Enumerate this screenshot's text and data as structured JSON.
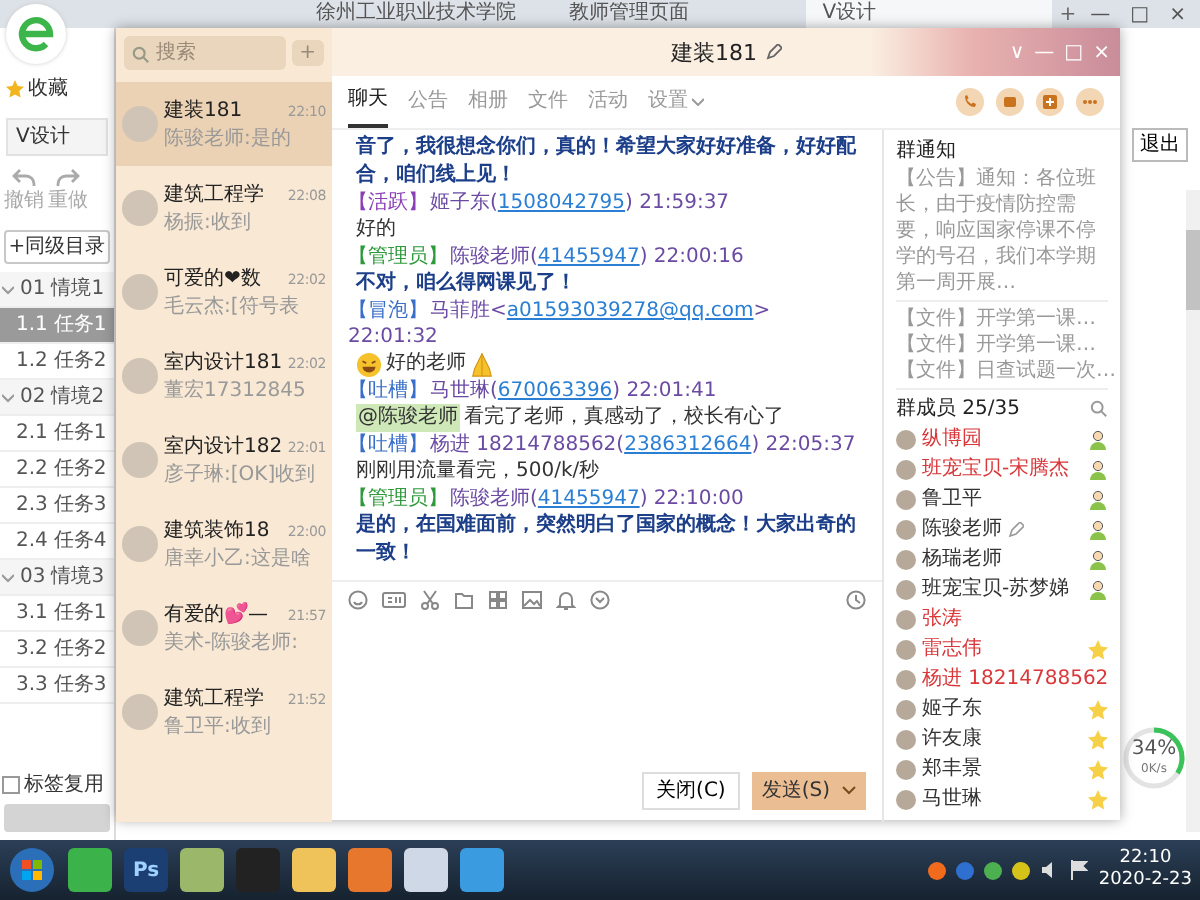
{
  "browser": {
    "tabs": [
      {
        "label": "徐州工业职业技术学院",
        "selected": false
      },
      {
        "label": "教师管理页面",
        "selected": false
      },
      {
        "label": "V设计",
        "selected": true
      }
    ],
    "new_tab": "+",
    "window_controls": [
      "—",
      "□",
      "×"
    ],
    "bookmarks": "收藏",
    "doc_tab": "V设计",
    "undo": "撤销",
    "redo": "重做",
    "add_sibling": "+同级目录",
    "outline": [
      {
        "num": "01",
        "label": "情境1",
        "expanded": true,
        "selected": false,
        "children": [
          {
            "num": "1.1",
            "label": "任务1",
            "selected": true
          },
          {
            "num": "1.2",
            "label": "任务2",
            "selected": false
          }
        ]
      },
      {
        "num": "02",
        "label": "情境2",
        "expanded": true,
        "selected": false,
        "children": [
          {
            "num": "2.1",
            "label": "任务1",
            "selected": false
          },
          {
            "num": "2.2",
            "label": "任务2",
            "selected": false
          },
          {
            "num": "2.3",
            "label": "任务3",
            "selected": false
          },
          {
            "num": "2.4",
            "label": "任务4",
            "selected": false
          }
        ]
      },
      {
        "num": "03",
        "label": "情境3",
        "expanded": true,
        "selected": false,
        "children": [
          {
            "num": "3.1",
            "label": "任务1",
            "selected": false
          },
          {
            "num": "3.2",
            "label": "任务2",
            "selected": false
          },
          {
            "num": "3.3",
            "label": "任务3",
            "selected": false
          }
        ]
      }
    ],
    "reuse_tags": {
      "label": "标签复用",
      "checked": false
    },
    "exit": "退出",
    "speed": {
      "percent": "34%",
      "level": 0.34,
      "rate": "0K/s"
    }
  },
  "qq": {
    "search": {
      "placeholder": "搜索"
    },
    "add": "+",
    "conversations": [
      {
        "name": "建装181",
        "time": "22:10",
        "preview": "陈骏老师:是的",
        "selected": true
      },
      {
        "name": "建筑工程学",
        "time": "22:08",
        "preview": "杨振:收到",
        "selected": false
      },
      {
        "name": "可爱的❤数",
        "time": "22:02",
        "preview": "毛云杰:[符号表",
        "selected": false
      },
      {
        "name": "室内设计181",
        "time": "22:02",
        "preview": "董宏17312845",
        "selected": false
      },
      {
        "name": "室内设计182",
        "time": "22:01",
        "preview": "彦子琳:[OK]收到",
        "selected": false
      },
      {
        "name": "建筑装饰18",
        "time": "22:00",
        "preview": "唐幸小乙:这是啥",
        "selected": false
      },
      {
        "name": "有爱的💕—",
        "time": "21:57",
        "preview": "美术-陈骏老师:",
        "selected": false
      },
      {
        "name": "建筑工程学",
        "time": "21:52",
        "preview": "鲁卫平:收到",
        "selected": false
      }
    ],
    "title": "建装181",
    "window_controls": [
      "∨",
      "—",
      "□",
      "×"
    ],
    "tabs": [
      {
        "label": "聊天",
        "selected": true,
        "dropdown": false
      },
      {
        "label": "公告",
        "selected": false,
        "dropdown": false
      },
      {
        "label": "相册",
        "selected": false,
        "dropdown": false
      },
      {
        "label": "文件",
        "selected": false,
        "dropdown": false
      },
      {
        "label": "活动",
        "selected": false,
        "dropdown": false
      },
      {
        "label": "设置",
        "selected": false,
        "dropdown": true
      }
    ],
    "messages": [
      {
        "body": {
          "kind": "bold",
          "text": "音了，我很想念你们，真的！希望大家好好准备，好好配合，咱们线上见！"
        }
      },
      {
        "header": {
          "role": "【活跃】",
          "color": "#8a3fb5",
          "sender": "姬子东",
          "open": "(",
          "contact": "1508042795",
          "close": ")",
          "time": "21:59:37"
        },
        "body": {
          "kind": "plain",
          "text": "好的"
        }
      },
      {
        "header": {
          "role": "【管理员】",
          "color": "#2e9a3c",
          "sender": "陈骏老师",
          "open": "(",
          "contact": "41455947",
          "close": ")",
          "time": "22:00:16"
        },
        "body": {
          "kind": "bold",
          "text": "不对，咱么得网课见了！"
        }
      },
      {
        "header": {
          "role": "【冒泡】",
          "color": "#3a6fc9",
          "sender": "马菲胜",
          "open": "<",
          "contact": "a01593039278@qq.com",
          "close": ">",
          "time": "22:01:32"
        },
        "body": {
          "kind": "emoji",
          "text": "好的老师"
        }
      },
      {
        "header": {
          "role": "【吐槽】",
          "color": "#3a6fc9",
          "sender": "马世琳",
          "open": "(",
          "contact": "670063396",
          "close": ")",
          "time": "22:01:41"
        },
        "body": {
          "kind": "mention",
          "mention": "@陈骏老师",
          "text": "看完了老师，真感动了，校长有心了"
        }
      },
      {
        "header": {
          "role": "【吐槽】",
          "color": "#3a6fc9",
          "sender": "杨进 18214788562",
          "open": "(",
          "contact": "2386312664",
          "close": ")",
          "time": "22:05:37"
        },
        "body": {
          "kind": "plain",
          "text": "刚刚用流量看完，500/k/秒"
        }
      },
      {
        "header": {
          "role": "【管理员】",
          "color": "#2e9a3c",
          "sender": "陈骏老师",
          "open": "(",
          "contact": "41455947",
          "close": ")",
          "time": "22:10:00"
        },
        "body": {
          "kind": "bold",
          "text": "是的，在国难面前，突然明白了国家的概念！大家出奇的一致！"
        }
      }
    ],
    "close_button": "关闭(C)",
    "send_button": "发送(S)",
    "notice": {
      "title": "群通知",
      "text": "【公告】通知：各位班长，由于疫情防控需要，响应国家停课不停学的号召，我们本学期第一周开展…",
      "files": [
        "【文件】开学第一课…",
        "【文件】开学第一课…",
        "【文件】日查试题一次…"
      ]
    },
    "members_title": "群成员 25/35",
    "members": [
      {
        "name": "纵博园",
        "color": "#d9373a",
        "kind": "admin",
        "editing": false
      },
      {
        "name": "班宠宝贝-宋腾杰",
        "color": "#d9373a",
        "kind": "admin",
        "editing": false
      },
      {
        "name": "鲁卫平",
        "color": "#333333",
        "kind": "admin",
        "editing": false
      },
      {
        "name": "陈骏老师",
        "color": "#333333",
        "kind": "admin",
        "editing": true
      },
      {
        "name": "杨瑞老师",
        "color": "#333333",
        "kind": "admin",
        "editing": false
      },
      {
        "name": "班宠宝贝-苏梦娣",
        "color": "#333333",
        "kind": "admin",
        "editing": false
      },
      {
        "name": "张涛",
        "color": "#d9373a",
        "kind": "plain",
        "editing": false
      },
      {
        "name": "雷志伟",
        "color": "#d9373a",
        "kind": "star",
        "editing": false
      },
      {
        "name": "杨进 18214788562",
        "color": "#d9373a",
        "kind": "plain",
        "editing": false
      },
      {
        "name": "姬子东",
        "color": "#333333",
        "kind": "star",
        "editing": false
      },
      {
        "name": "许友康",
        "color": "#333333",
        "kind": "star",
        "editing": false
      },
      {
        "name": "郑丰景",
        "color": "#333333",
        "kind": "star",
        "editing": false
      },
      {
        "name": "马世琳",
        "color": "#333333",
        "kind": "star",
        "editing": false
      }
    ]
  },
  "taskbar": {
    "apps": [
      {
        "kind": "browser"
      },
      {
        "kind": "photoshop",
        "label": "Ps"
      },
      {
        "kind": "image"
      },
      {
        "kind": "qq"
      },
      {
        "kind": "notes"
      },
      {
        "kind": "slides"
      },
      {
        "kind": "chat"
      },
      {
        "kind": "player"
      }
    ],
    "time": "22:10",
    "date": "2020-2-23"
  }
}
